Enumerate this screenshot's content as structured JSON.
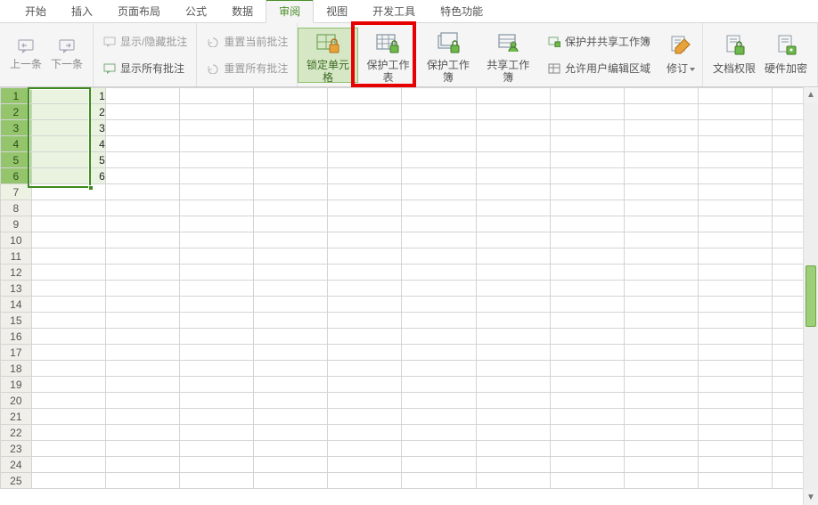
{
  "menu": {
    "items": [
      {
        "label": "开始",
        "active": false
      },
      {
        "label": "插入",
        "active": false
      },
      {
        "label": "页面布局",
        "active": false
      },
      {
        "label": "公式",
        "active": false
      },
      {
        "label": "数据",
        "active": false
      },
      {
        "label": "审阅",
        "active": true
      },
      {
        "label": "视图",
        "active": false
      },
      {
        "label": "开发工具",
        "active": false
      },
      {
        "label": "特色功能",
        "active": false
      }
    ]
  },
  "ribbon": {
    "nav": {
      "prev": "上一条",
      "next": "下一条"
    },
    "comments": {
      "showHide": "显示/隐藏批注",
      "resetCurrent": "重置当前批注",
      "showAll": "显示所有批注",
      "resetAll": "重置所有批注"
    },
    "protect": {
      "lockCell": "锁定单元格",
      "protectSheet": "保护工作表",
      "protectWorkbook": "保护工作簿",
      "shareWorkbook": "共享工作簿",
      "protectAndShare": "保护并共享工作簿",
      "allowUsersEditRanges": "允许用户编辑区域",
      "revise": "修订"
    },
    "security": {
      "docPermission": "文档权限",
      "hardwareEncrypt": "硬件加密"
    }
  },
  "sheet": {
    "rowCount": 25,
    "colA": [
      "1",
      "2",
      "3",
      "4",
      "5",
      "6"
    ],
    "selectedRows": [
      1,
      2,
      3,
      4,
      5,
      6
    ]
  },
  "colors": {
    "accent": "#4a8e28",
    "highlightBox": "#e60000"
  },
  "scrollbar": {
    "thumbTopPct": 42,
    "thumbHeightPct": 16
  }
}
